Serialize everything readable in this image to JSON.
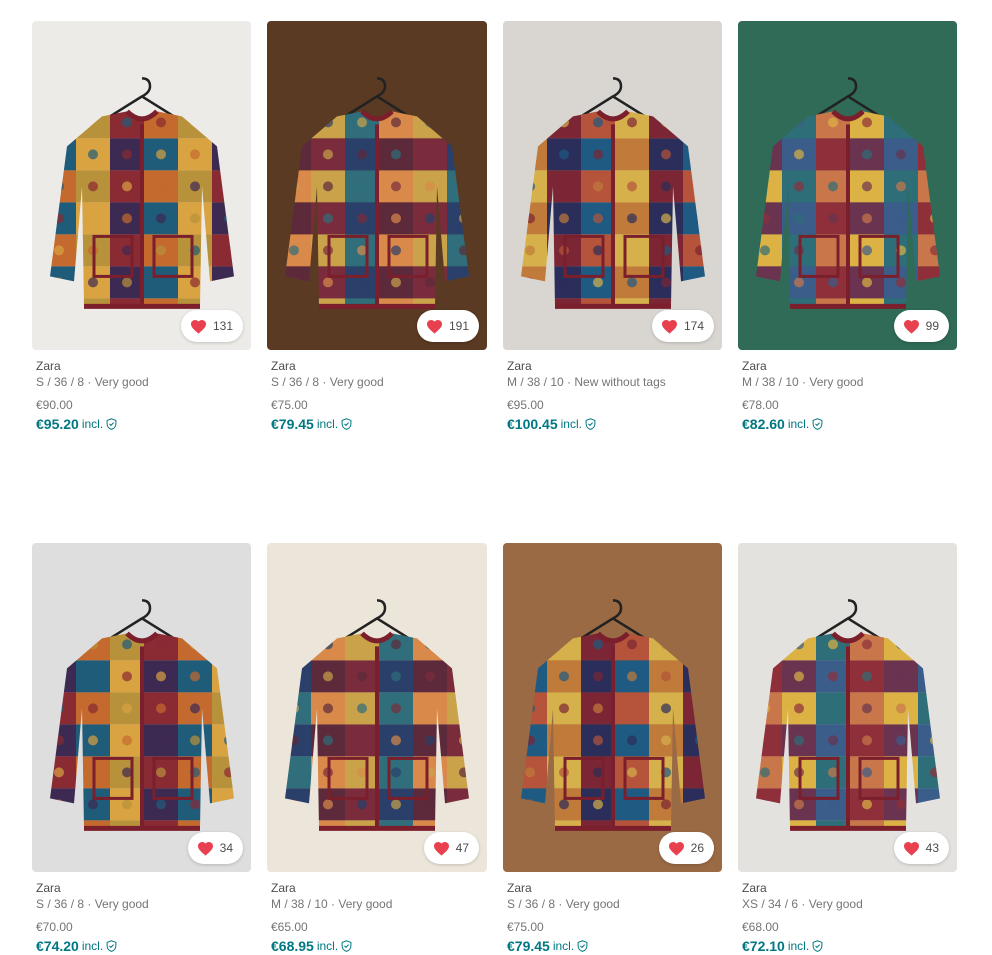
{
  "colors": {
    "accent": "#007782",
    "heart": "#e8404f",
    "text": "#4d4d4d",
    "muted": "#757575"
  },
  "items": [
    {
      "brand": "Zara",
      "subtitle": "S / 36 / 8 · Very good",
      "price": "€90.00",
      "total": "€95.20",
      "incl": "incl.",
      "favorites": "131",
      "bg": "#ecebe8",
      "icon": "heart-icon"
    },
    {
      "brand": "Zara",
      "subtitle": "S / 36 / 8 · Very good",
      "price": "€75.00",
      "total": "€79.45",
      "incl": "incl.",
      "favorites": "191",
      "bg": "#5a3a22",
      "icon": "heart-icon"
    },
    {
      "brand": "Zara",
      "subtitle": "M / 38 / 10 · New without tags",
      "price": "€95.00",
      "total": "€100.45",
      "incl": "incl.",
      "favorites": "174",
      "bg": "#d9d6d2",
      "icon": "heart-icon"
    },
    {
      "brand": "Zara",
      "subtitle": "M / 38 / 10 · Very good",
      "price": "€78.00",
      "total": "€82.60",
      "incl": "incl.",
      "favorites": "99",
      "bg": "#2f6b56",
      "icon": "heart-icon"
    },
    {
      "brand": "Zara",
      "subtitle": "S / 36 / 8 · Very good",
      "price": "€70.00",
      "total": "€74.20",
      "incl": "incl.",
      "favorites": "34",
      "bg": "#dedede",
      "icon": "heart-icon"
    },
    {
      "brand": "Zara",
      "subtitle": "M / 38 / 10 · Very good",
      "price": "€65.00",
      "total": "€68.95",
      "incl": "incl.",
      "favorites": "47",
      "bg": "#ece6da",
      "icon": "heart-icon"
    },
    {
      "brand": "Zara",
      "subtitle": "S / 36 / 8 · Very good",
      "price": "€75.00",
      "total": "€79.45",
      "incl": "incl.",
      "favorites": "26",
      "bg": "#9a6a45",
      "icon": "heart-icon"
    },
    {
      "brand": "Zara",
      "subtitle": "XS / 34 / 6 · Very good",
      "price": "€68.00",
      "total": "€72.10",
      "incl": "incl.",
      "favorites": "43",
      "bg": "#e4e2df",
      "icon": "heart-icon"
    }
  ]
}
